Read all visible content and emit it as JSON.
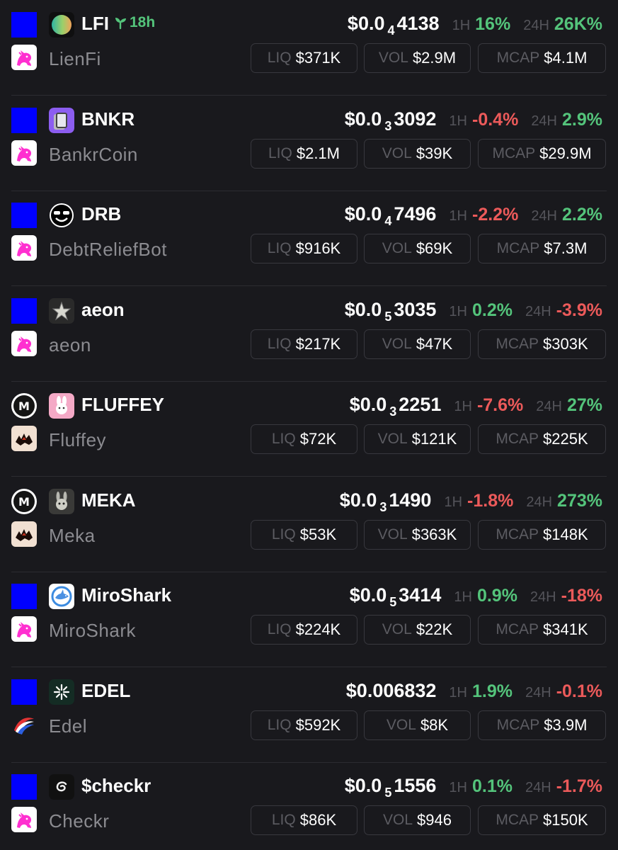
{
  "labels": {
    "h1": "1H",
    "h24": "24H",
    "liq": "LIQ",
    "vol": "VOL",
    "mcap": "MCAP"
  },
  "colors": {
    "positive": "#54c47b",
    "negative": "#ec5a5a",
    "chain_blue": "#0000ff",
    "background": "#19191d"
  },
  "tokens": [
    {
      "ticker": "LFI",
      "age": "18h",
      "name": "LienFi",
      "chain_icon": "blue-square-icon",
      "logo_icon": "gradient-orb-icon",
      "dex_icon": "uniswap-unicorn-icon",
      "price_prefix": "$0.0",
      "price_sub": "4",
      "price_digits": "4138",
      "h1": "16%",
      "h1_dir": "pos",
      "h24": "26K%",
      "h24_dir": "pos",
      "liq": "$371K",
      "vol": "$2.9M",
      "mcap": "$4.1M"
    },
    {
      "ticker": "BNKR",
      "age": "",
      "name": "BankrCoin",
      "chain_icon": "blue-square-icon",
      "logo_icon": "bankr-phone-icon",
      "dex_icon": "uniswap-unicorn-icon",
      "price_prefix": "$0.0",
      "price_sub": "3",
      "price_digits": "3092",
      "h1": "-0.4%",
      "h1_dir": "neg",
      "h24": "2.9%",
      "h24_dir": "pos",
      "liq": "$2.1M",
      "vol": "$39K",
      "mcap": "$29.9M"
    },
    {
      "ticker": "DRB",
      "age": "",
      "name": "DebtReliefBot",
      "chain_icon": "blue-square-icon",
      "logo_icon": "sunglasses-smiley-icon",
      "dex_icon": "uniswap-unicorn-icon",
      "price_prefix": "$0.0",
      "price_sub": "4",
      "price_digits": "7496",
      "h1": "-2.2%",
      "h1_dir": "neg",
      "h24": "2.2%",
      "h24_dir": "pos",
      "liq": "$916K",
      "vol": "$69K",
      "mcap": "$7.3M"
    },
    {
      "ticker": "aeon",
      "age": "",
      "name": "aeon",
      "chain_icon": "blue-square-icon",
      "logo_icon": "star-icon",
      "dex_icon": "uniswap-unicorn-icon",
      "price_prefix": "$0.0",
      "price_sub": "5",
      "price_digits": "3035",
      "h1": "0.2%",
      "h1_dir": "pos",
      "h24": "-3.9%",
      "h24_dir": "neg",
      "liq": "$217K",
      "vol": "$47K",
      "mcap": "$303K"
    },
    {
      "ticker": "FLUFFEY",
      "age": "",
      "name": "Fluffey",
      "chain_icon": "m-circle-icon",
      "logo_icon": "bunny-icon",
      "dex_icon": "meka-dex-icon",
      "price_prefix": "$0.0",
      "price_sub": "3",
      "price_digits": "2251",
      "h1": "-7.6%",
      "h1_dir": "neg",
      "h24": "27%",
      "h24_dir": "pos",
      "liq": "$72K",
      "vol": "$121K",
      "mcap": "$225K"
    },
    {
      "ticker": "MEKA",
      "age": "",
      "name": "Meka",
      "chain_icon": "m-circle-icon",
      "logo_icon": "robot-rabbit-icon",
      "dex_icon": "meka-dex-icon",
      "price_prefix": "$0.0",
      "price_sub": "3",
      "price_digits": "1490",
      "h1": "-1.8%",
      "h1_dir": "neg",
      "h24": "273%",
      "h24_dir": "pos",
      "liq": "$53K",
      "vol": "$363K",
      "mcap": "$148K"
    },
    {
      "ticker": "MiroShark",
      "age": "",
      "name": "MiroShark",
      "chain_icon": "blue-square-icon",
      "logo_icon": "shark-icon",
      "dex_icon": "uniswap-unicorn-icon",
      "price_prefix": "$0.0",
      "price_sub": "5",
      "price_digits": "3414",
      "h1": "0.9%",
      "h1_dir": "pos",
      "h24": "-18%",
      "h24_dir": "neg",
      "liq": "$224K",
      "vol": "$22K",
      "mcap": "$341K"
    },
    {
      "ticker": "EDEL",
      "age": "",
      "name": "Edel",
      "chain_icon": "blue-square-icon",
      "logo_icon": "sparkle-icon",
      "dex_icon": "edel-swoosh-icon",
      "price_prefix": "$0.006832",
      "price_sub": "",
      "price_digits": "",
      "h1": "1.9%",
      "h1_dir": "pos",
      "h24": "-0.1%",
      "h24_dir": "neg",
      "liq": "$592K",
      "vol": "$8K",
      "mcap": "$3.9M"
    },
    {
      "ticker": "$checkr",
      "age": "",
      "name": "Checkr",
      "chain_icon": "blue-square-icon",
      "logo_icon": "swirl-icon",
      "dex_icon": "uniswap-unicorn-icon",
      "price_prefix": "$0.0",
      "price_sub": "5",
      "price_digits": "1556",
      "h1": "0.1%",
      "h1_dir": "pos",
      "h24": "-1.7%",
      "h24_dir": "neg",
      "liq": "$86K",
      "vol": "$946",
      "mcap": "$150K"
    }
  ]
}
